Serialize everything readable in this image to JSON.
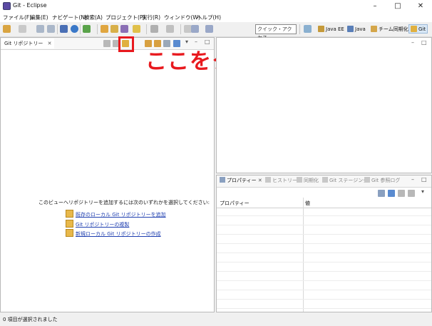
{
  "window": {
    "title": "Git - Eclipse"
  },
  "menu": [
    "ファイル(F)",
    "編集(E)",
    "ナビゲート(N)",
    "検索(A)",
    "プロジェクト(P)",
    "実行(R)",
    "ウィンドウ(W)",
    "ヘルプ(H)"
  ],
  "toolbar": {
    "quick_access_placeholder": "クイック・アクセス"
  },
  "perspectives": [
    "Java EE",
    "Java",
    "チーム同期化",
    "Git"
  ],
  "left_view": {
    "tab_label": "Git リポジトリー",
    "empty_message": "このビューへリポジトリーを追加するには次のいずれかを選択してください:",
    "links": [
      "既存のローカル Git リポジトリーを追加",
      "Git リポジトリーの複製",
      "新規ローカル Git リポジトリーの作成"
    ]
  },
  "annotation": {
    "callout": "ここをクリック",
    "color": "#e8191e"
  },
  "bottom_view": {
    "tabs": [
      "プロパティー",
      "ヒストリー",
      "同期化",
      "Git ステージング",
      "Git 参照ログ"
    ],
    "columns": [
      "プロパティー",
      "値"
    ]
  },
  "status": {
    "text": "0 項目が選択されました"
  }
}
